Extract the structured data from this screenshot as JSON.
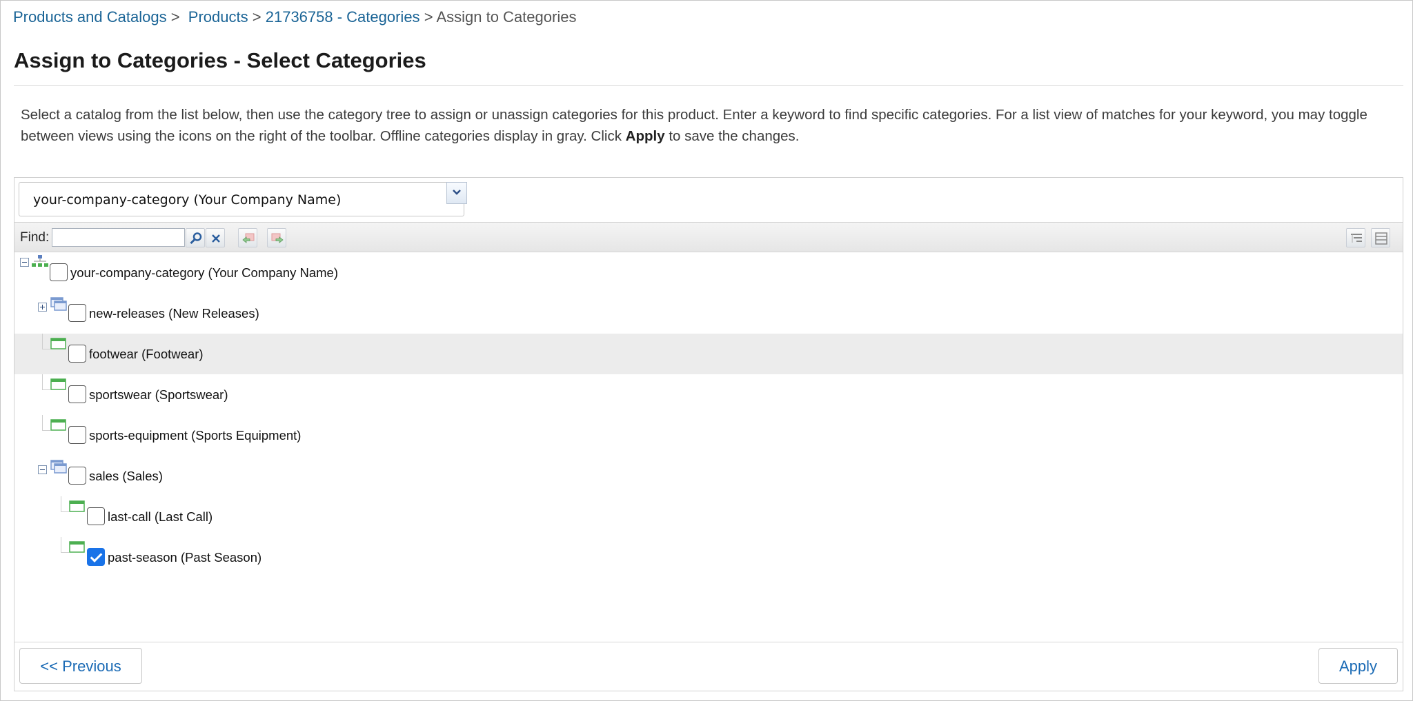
{
  "breadcrumb": {
    "items": [
      "Products and Catalogs",
      "Products",
      "21736758 - Categories"
    ],
    "current": "Assign to Categories",
    "separator": ">"
  },
  "page": {
    "title": "Assign to Categories - Select Categories"
  },
  "instructions": {
    "text_before": "Select a catalog from the list below, then use the category tree to assign or unassign categories for this product. Enter a keyword to find specific categories. For a list view of matches for your keyword, you may toggle between views using the icons on the right of the toolbar. Offline categories display in gray. Click ",
    "bold": "Apply",
    "text_after": " to save the changes."
  },
  "catalog_select": {
    "value": "your-company-category (Your Company Name)"
  },
  "toolbar": {
    "find_label": "Find:",
    "find_value": ""
  },
  "tree": {
    "nodes": [
      {
        "label": "your-company-category (Your Company Name)",
        "checked": false,
        "level": 0,
        "type": "root",
        "expander": "minus"
      },
      {
        "label": "new-releases (New Releases)",
        "checked": false,
        "level": 1,
        "type": "folder",
        "expander": "plus"
      },
      {
        "label": "footwear (Footwear)",
        "checked": false,
        "level": 1,
        "type": "leaf",
        "highlighted": true
      },
      {
        "label": "sportswear (Sportswear)",
        "checked": false,
        "level": 1,
        "type": "leaf"
      },
      {
        "label": "sports-equipment (Sports Equipment)",
        "checked": false,
        "level": 1,
        "type": "leaf"
      },
      {
        "label": "sales (Sales)",
        "checked": false,
        "level": 1,
        "type": "folder",
        "expander": "minus"
      },
      {
        "label": "last-call (Last Call)",
        "checked": false,
        "level": 2,
        "type": "leaf"
      },
      {
        "label": "past-season (Past Season)",
        "checked": true,
        "level": 2,
        "type": "leaf"
      }
    ]
  },
  "footer": {
    "previous_label": "<< Previous",
    "apply_label": "Apply"
  },
  "colors": {
    "link": "#1a6496",
    "checkbox_checked": "#1a73e8",
    "row_highlight": "#ececec",
    "folder_icon": "#7a9ad0",
    "leaf_icon": "#4caf50"
  }
}
